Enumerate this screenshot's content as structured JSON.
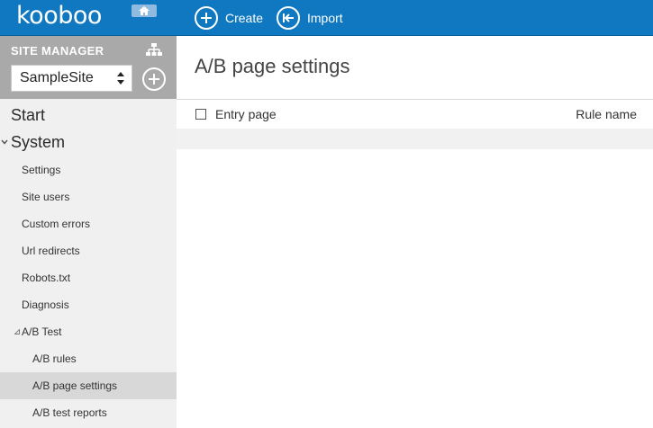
{
  "topbar": {
    "logo_text": "kooboo",
    "home_icon": "home-icon",
    "actions": [
      {
        "label": "Create",
        "icon": "plus-circle-icon"
      },
      {
        "label": "Import",
        "icon": "import-circle-icon"
      }
    ]
  },
  "sidebar": {
    "site_manager_label": "SITE MANAGER",
    "sitemap_icon": "sitemap-icon",
    "selected_site": "SampleSite",
    "add_site_icon": "plus-circle-icon",
    "items": [
      {
        "label": "Start",
        "level": 0
      },
      {
        "label": "System",
        "level": 0,
        "expanded": true
      },
      {
        "label": "Settings",
        "level": 1
      },
      {
        "label": "Site users",
        "level": 1
      },
      {
        "label": "Custom errors",
        "level": 1
      },
      {
        "label": "Url redirects",
        "level": 1
      },
      {
        "label": "Robots.txt",
        "level": 1
      },
      {
        "label": "Diagnosis",
        "level": 1
      },
      {
        "label": "A/B Test",
        "level": 1,
        "expanded": true
      },
      {
        "label": "A/B rules",
        "level": 2
      },
      {
        "label": "A/B page settings",
        "level": 2,
        "active": true
      },
      {
        "label": "A/B test reports",
        "level": 2
      }
    ]
  },
  "main": {
    "title": "A/B page settings",
    "columns": [
      "Entry page",
      "Rule name"
    ]
  },
  "colors": {
    "topbar": "#1078c0",
    "sidebar_header": "#a9a9a9",
    "sidebar_bg": "#f0f0f0",
    "active_item": "#d8d8d8"
  }
}
